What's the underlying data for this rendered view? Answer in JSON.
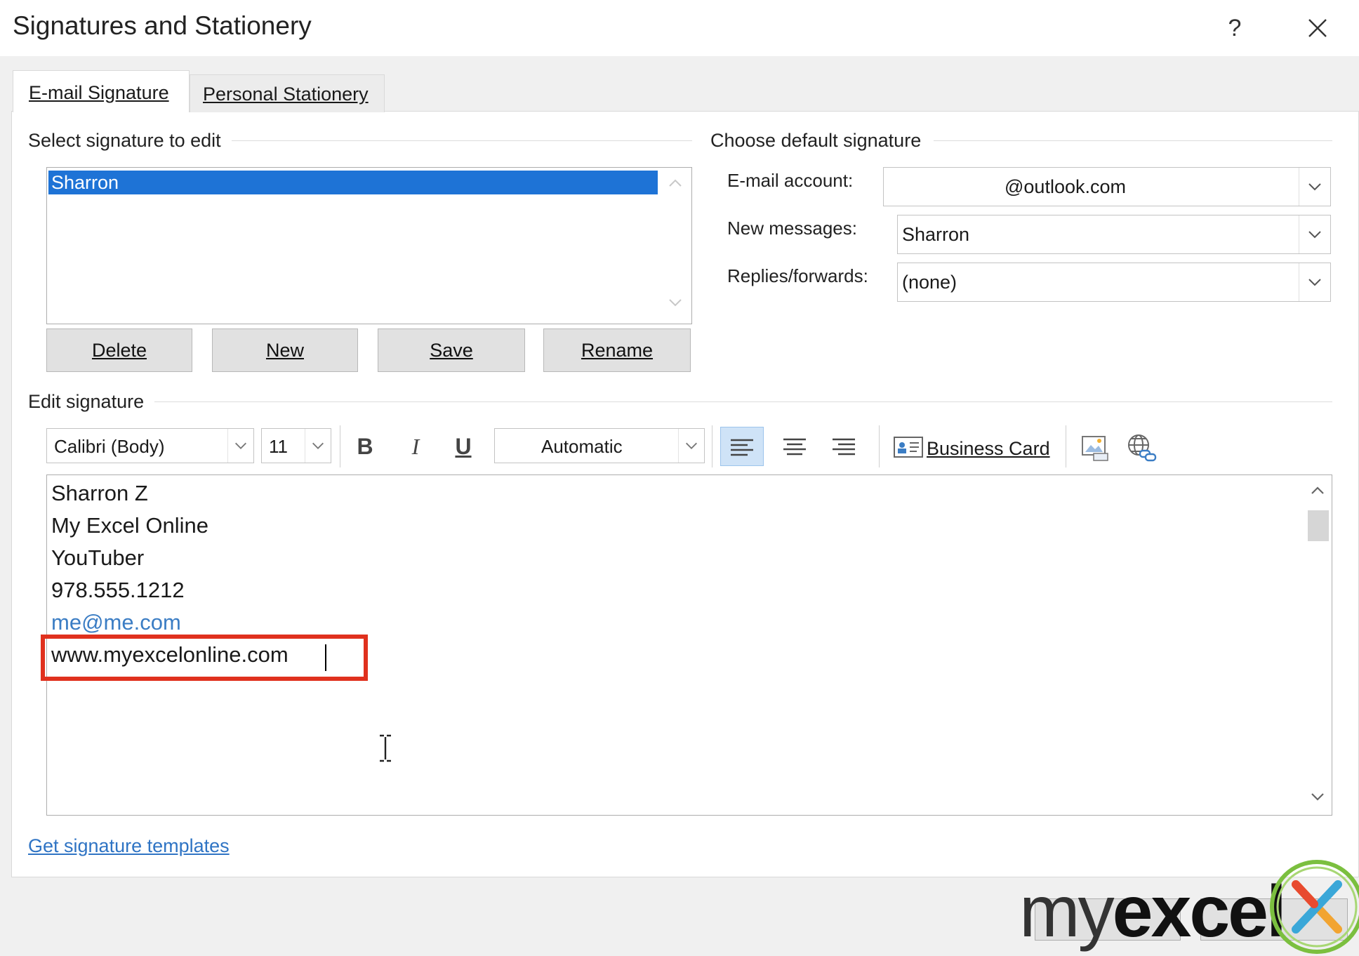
{
  "window": {
    "title": "Signatures and Stationery",
    "help_label": "?",
    "close_icon": "close-icon"
  },
  "tabs": [
    {
      "label": "E-mail Signature",
      "active": true
    },
    {
      "label": "Personal Stationery",
      "active": false
    }
  ],
  "select_section": {
    "label": "Select signature to edit",
    "items": [
      "Sharron"
    ],
    "selected": "Sharron",
    "buttons": {
      "delete": "Delete",
      "new": "New",
      "save": "Save",
      "rename": "Rename"
    }
  },
  "default_section": {
    "label": "Choose default signature",
    "email_account_label": "E-mail account:",
    "email_account_value": "@outlook.com",
    "new_messages_label": "New messages:",
    "new_messages_value": "Sharron",
    "replies_label": "Replies/forwards:",
    "replies_value": "(none)"
  },
  "edit_section": {
    "label": "Edit signature",
    "font": "Calibri (Body)",
    "size": "11",
    "bold": "B",
    "italic": "I",
    "underline": "U",
    "color": "Automatic",
    "business_card_label": "Business Card",
    "lines": [
      "Sharron Z",
      "My Excel Online",
      "YouTuber",
      "978.555.1212",
      "me@me.com",
      "www.myexcelonline.com"
    ],
    "link_color": "#3b7dc4",
    "highlight_color": "#e0311e"
  },
  "templates_link": "Get signature templates",
  "watermark": {
    "text_light": "my",
    "text_bold": "excel"
  }
}
